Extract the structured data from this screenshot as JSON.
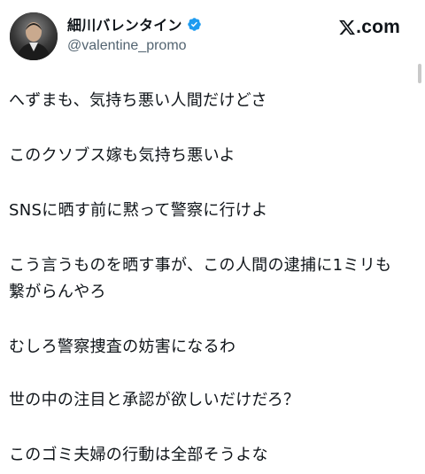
{
  "header": {
    "display_name": "細川バレンタイン",
    "handle": "@valentine_promo",
    "verified": true,
    "brand": "com",
    "brand_icon": "x-logo-icon"
  },
  "tweet": {
    "lines": [
      "へずまも、気持ち悪い人間だけどさ",
      "このクソブス嫁も気持ち悪いよ",
      "SNSに晒す前に黙って警察に行けよ",
      "こう言うものを晒す事が、この人間の逮捕に1ミリも",
      "繋がらんやろ",
      "むしろ警察捜査の妨害になるわ",
      "世の中の注目と承認が欲しいだけだろ？",
      "このゴミ夫婦の行動は全部そうよな"
    ]
  },
  "colors": {
    "text": "#0f1419",
    "secondary": "#536471",
    "verified_blue": "#1d9bf0",
    "background": "#ffffff"
  }
}
